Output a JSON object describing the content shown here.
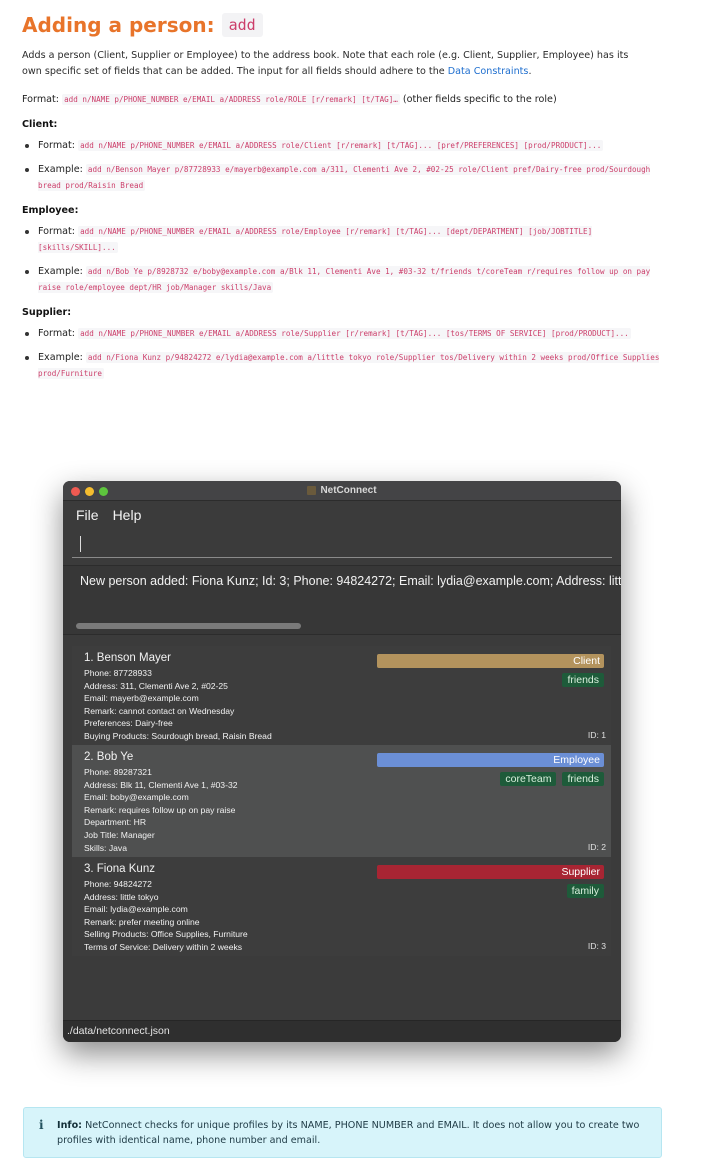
{
  "doc": {
    "title": "Adding a person:",
    "title_code": "add",
    "intro_pre": "Adds a person (Client, Supplier or Employee) to the address book. Note that each role (e.g. Client, Supplier, Employee) has its own specific set of fields that can be added. The input for all fields should adhere to the ",
    "intro_link": "Data Constraints",
    "intro_post": ".",
    "format_label": "Format:",
    "format_code": "add n/NAME p/PHONE_NUMBER e/EMAIL a/ADDRESS role/ROLE [r/remark] [t/TAG]…",
    "format_note": " (other fields specific to the role)",
    "sections": [
      {
        "heading": "Client:",
        "format_label": "Format:",
        "format_code": "add n/NAME p/PHONE_NUMBER e/EMAIL a/ADDRESS role/Client [r/remark] [t/TAG]... [pref/PREFERENCES] [prod/PRODUCT]...",
        "example_label": "Example:",
        "example_code": "add n/Benson Mayer p/87728933 e/mayerb@example.com a/311, Clementi Ave 2, #02-25 role/Client pref/Dairy-free prod/Sourdough bread prod/Raisin Bread"
      },
      {
        "heading": "Employee:",
        "format_label": "Format:",
        "format_code": "add n/NAME p/PHONE_NUMBER e/EMAIL a/ADDRESS role/Employee [r/remark] [t/TAG]... [dept/DEPARTMENT] [job/JOBTITLE] [skills/SKILL]...",
        "example_label": "Example:",
        "example_code": "add n/Bob Ye p/8928732 e/boby@example.com a/Blk 11, Clementi Ave 1, #03-32 t/friends t/coreTeam r/requires follow up on pay raise role/employee dept/HR job/Manager skills/Java"
      },
      {
        "heading": "Supplier:",
        "format_label": "Format:",
        "format_code": "add n/NAME p/PHONE_NUMBER e/EMAIL a/ADDRESS role/Supplier [r/remark] [t/TAG]... [tos/TERMS OF SERVICE] [prod/PRODUCT]...",
        "example_label": "Example:",
        "example_code": "add n/Fiona Kunz p/94824272 e/lydia@example.com a/little tokyo role/Supplier tos/Delivery within 2 weeks prod/Office Supplies prod/Furniture"
      }
    ]
  },
  "window": {
    "title": "NetConnect",
    "menu": [
      "File",
      "Help"
    ],
    "command_value": "",
    "result_text": "New person added: Fiona Kunz; Id: 3; Phone: 94824272; Email: lydia@example.com; Address: little tokyo",
    "status_path": "./data/netconnect.json",
    "persons": [
      {
        "name": "1.  Benson Mayer",
        "role": "Client",
        "role_color": "#b3935d",
        "tags": [
          "friends"
        ],
        "fields": [
          "Phone: 87728933",
          "Address: 311, Clementi Ave 2, #02-25",
          "Email: mayerb@example.com",
          "Remark: cannot contact on Wednesday",
          "Preferences: Dairy-free",
          "Buying Products: Sourdough bread, Raisin Bread"
        ],
        "id": "ID: 1"
      },
      {
        "name": "2.  Bob Ye",
        "role": "Employee",
        "role_color": "#6b8fd6",
        "tags": [
          "coreTeam",
          "friends"
        ],
        "fields": [
          "Phone: 89287321",
          "Address: Blk 11, Clementi Ave 1, #03-32",
          "Email: boby@example.com",
          "Remark: requires follow up on pay raise",
          "Department: HR",
          "Job Title: Manager",
          "Skills: Java"
        ],
        "id": "ID: 2"
      },
      {
        "name": "3.  Fiona Kunz",
        "role": "Supplier",
        "role_color": "#a82533",
        "tags": [
          "family"
        ],
        "fields": [
          "Phone: 94824272",
          "Address: little tokyo",
          "Email: lydia@example.com",
          "Remark: prefer meeting online",
          "Selling Products: Office Supplies, Furniture",
          "Terms of Service: Delivery within 2 weeks"
        ],
        "id": "ID: 3"
      }
    ]
  },
  "info": {
    "icon": "info-icon",
    "label": "Info:",
    "text": "NetConnect checks for unique profiles by its NAME, PHONE NUMBER and EMAIL. It does not allow you to create two profiles with identical name, phone number and email."
  }
}
